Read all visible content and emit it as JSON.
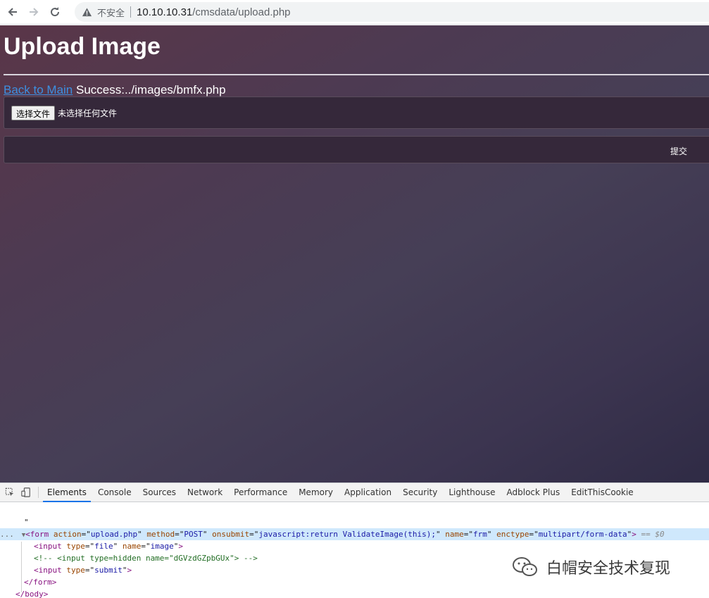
{
  "browser": {
    "security_label": "不安全",
    "url_host": "10.10.10.31",
    "url_path": "/cmsdata/upload.php"
  },
  "page": {
    "title": "Upload Image",
    "back_link": "Back to Main",
    "status_text": " Success:../images/bmfx.php",
    "choose_file_label": "选择文件",
    "no_file_text": "未选择任何文件",
    "submit_label": "提交"
  },
  "devtools": {
    "tabs": [
      "Elements",
      "Console",
      "Sources",
      "Network",
      "Performance",
      "Memory",
      "Application",
      "Security",
      "Lighthouse",
      "Adblock Plus",
      "EditThisCookie"
    ],
    "active_tab": "Elements",
    "code": {
      "quote": "\"",
      "ellipsis": "...",
      "form_tag": "form",
      "form_action_attr": "action",
      "form_action_val": "upload.php",
      "form_method_attr": "method",
      "form_method_val": "POST",
      "form_onsubmit_attr": "onsubmit",
      "form_onsubmit_val": "javascript:return ValidateImage(this);",
      "form_name_attr": "name",
      "form_name_val": "frm",
      "form_enctype_attr": "enctype",
      "form_enctype_val": "multipart/form-data",
      "selected_marker": "== $0",
      "input1_tag": "input",
      "input1_type_attr": "type",
      "input1_type_val": "file",
      "input1_name_attr": "name",
      "input1_name_val": "image",
      "comment": "<!-- <input type=hidden name=\"dGVzdGZpbGUx\"> -->",
      "input2_tag": "input",
      "input2_type_attr": "type",
      "input2_type_val": "submit",
      "close_form": "</form>",
      "close_body": "</body>"
    }
  },
  "watermark": {
    "text": "白帽安全技术复现"
  },
  "colors": {
    "link": "#3d8fe0",
    "active_tab_underline": "#1a73e8",
    "selected_row": "#cfe8fc"
  }
}
